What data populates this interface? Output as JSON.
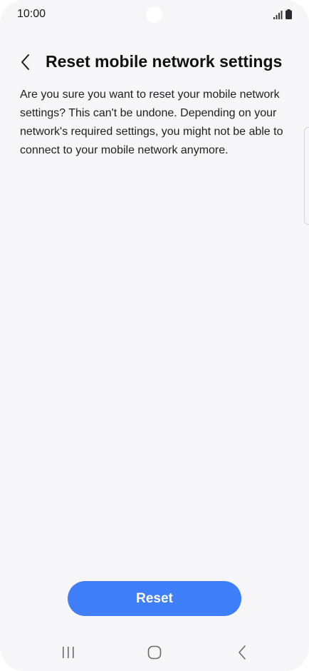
{
  "status_bar": {
    "time": "10:00",
    "icons": [
      "signal-icon",
      "battery-icon"
    ]
  },
  "header": {
    "back_icon": "chevron-left-icon",
    "title": "Reset mobile network settings"
  },
  "body": {
    "description": "Are you sure you want to reset your mobile network settings? This can't be undone. Depending on your network's required settings, you might not be able to connect to your mobile network anymore."
  },
  "actions": {
    "reset_label": "Reset"
  },
  "nav_bar": {
    "items": [
      "recent-apps-icon",
      "home-icon",
      "back-icon"
    ]
  },
  "colors": {
    "background": "#f6f6f8",
    "accent": "#3e7ef8",
    "text": "#1f1f1f"
  }
}
